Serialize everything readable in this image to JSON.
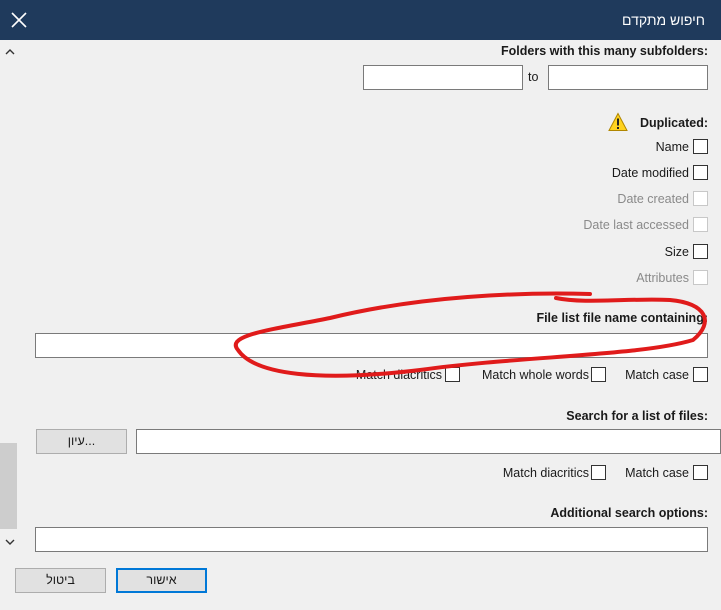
{
  "window": {
    "title": "חיפוש מתקדם"
  },
  "sections": {
    "subfolders": {
      "heading": "Folders with this many subfolders:",
      "to_label": "to",
      "from_value": "",
      "to_value": ""
    },
    "duplicated": {
      "heading": "Duplicated:",
      "items": [
        {
          "label": "Name",
          "enabled": true,
          "checked": false
        },
        {
          "label": "Date modified",
          "enabled": true,
          "checked": false
        },
        {
          "label": "Date created",
          "enabled": false,
          "checked": false
        },
        {
          "label": "Date last accessed",
          "enabled": false,
          "checked": false
        },
        {
          "label": "Size",
          "enabled": true,
          "checked": false
        },
        {
          "label": "Attributes",
          "enabled": false,
          "checked": false
        }
      ]
    },
    "file_list_name": {
      "heading": "File list file name containing:",
      "value": "",
      "options": {
        "match_diacritics": "Match diacritics",
        "match_whole_words": "Match whole words",
        "match_case": "Match case"
      }
    },
    "search_list": {
      "heading": "Search for a list of files:",
      "browse_label": "עיון...",
      "value": "",
      "options": {
        "match_diacritics": "Match diacritics",
        "match_case": "Match case"
      }
    },
    "additional": {
      "heading": "Additional search options:",
      "value": ""
    }
  },
  "footer": {
    "ok_label": "אישור",
    "cancel_label": "ביטול"
  },
  "colors": {
    "titlebar": "#1f3a5c",
    "accent": "#0078d7",
    "annotation": "#e01b1b"
  },
  "icons": {
    "close": "close-icon",
    "warning": "warning-icon",
    "scroll_up": "chevron-up-icon",
    "scroll_down": "chevron-down-icon"
  }
}
